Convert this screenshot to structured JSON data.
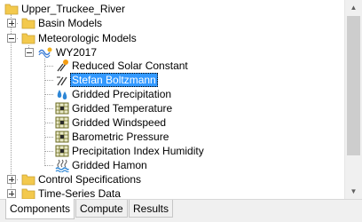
{
  "tree": {
    "root": "Upper_Truckee_River",
    "basin_models": "Basin Models",
    "meteorologic_models": "Meteorologic Models",
    "model": "WY2017",
    "items": [
      "Reduced Solar Constant",
      "Stefan Boltzmann",
      "Gridded Precipitation",
      "Gridded Temperature",
      "Gridded Windspeed",
      "Barometric Pressure",
      "Precipitation Index Humidity",
      "Gridded Hamon"
    ],
    "control_specifications": "Control Specifications",
    "time_series_data": "Time-Series Data"
  },
  "tabs": [
    {
      "label": "Components"
    },
    {
      "label": "Compute"
    },
    {
      "label": "Results"
    }
  ],
  "icons": {
    "folder": "folder-icon",
    "sun": "sun-icon",
    "radiation": "radiation-icon",
    "precip": "precipitation-icon",
    "grid": "gridded-data-icon",
    "hamon": "evapotranspiration-icon",
    "met": "meteorologic-model-icon"
  },
  "colors": {
    "selection": "#3399ff",
    "folder": "#f3c94d"
  }
}
